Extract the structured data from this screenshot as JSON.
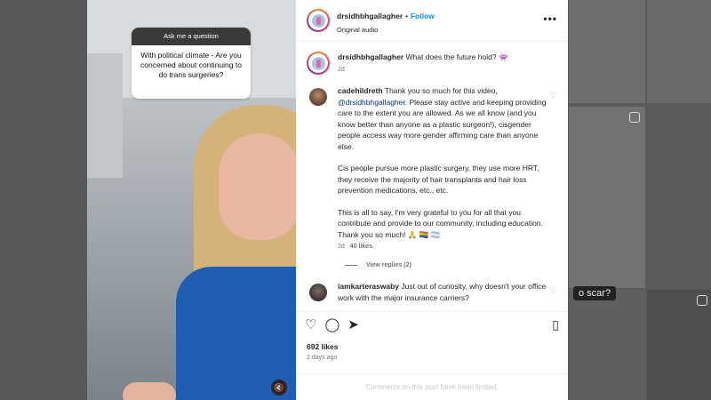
{
  "story_card": {
    "header": "Ask me a question",
    "question": "With political climate - Are you concerned about continuing to do trans surgeries?"
  },
  "post": {
    "author": "drsidhbhgallagher",
    "follow_label": "Follow",
    "audio": "Original audio",
    "caption": {
      "username": "drsidhbhgallagher",
      "text": "What does the future hold? 👾",
      "time": "2d"
    }
  },
  "comments": [
    {
      "username": "cadehildreth",
      "p1_a": "Thank you so much for this video, ",
      "p1_mention": "@drsidhbhgallagher",
      "p1_b": ". Please stay active and keeping providing care to the extent you are allowed. As we all know (and you know better than anyone as a plastic surgeon!), cisgender people access way more gender affirming care than anyone else.",
      "p2": "Cis people pursue more plastic surgery, they use more HRT, they receive the majority of hair transplants and hair loss prevention medications, etc., etc.",
      "p3": "This is all to say, I'm very grateful to you for all that you contribute and provide to our community, including education. Thank you so much! 🙏 🏳️‍🌈 🏳️‍⚧️",
      "time": "2d",
      "likes": "40 likes",
      "view_replies": "View replies (2)"
    },
    {
      "username": "iamkarteraswaby",
      "text": "Just out of curiosity, why doesn't your office work with the major insurance carriers?"
    }
  ],
  "engagement": {
    "likes": "692 likes",
    "date": "2 days ago",
    "limited_notice": "Comments on this post have been limited."
  },
  "background": {
    "thumb_caption": "o scar?"
  },
  "icons": {
    "heart": "heart-icon",
    "comment": "comment-icon",
    "share": "share-icon",
    "save": "save-icon",
    "mute": "mute-icon",
    "more": "more-icon"
  },
  "colors": {
    "follow": "#0095f6",
    "mention": "#00376b",
    "muted_text": "#737373"
  }
}
